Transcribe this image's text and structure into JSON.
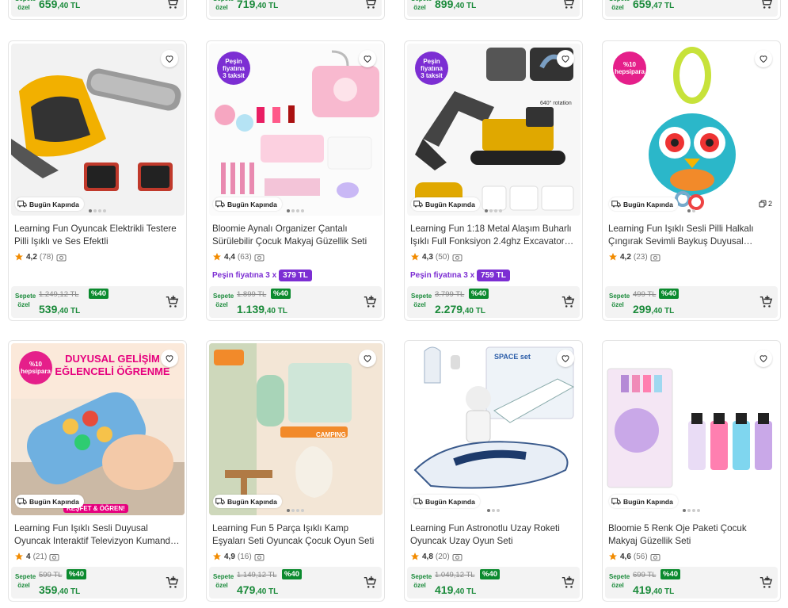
{
  "top_row": [
    {
      "price_main": "659",
      "price_dec": ",40 TL"
    },
    {
      "price_main": "719",
      "price_dec": ",40 TL"
    },
    {
      "price_main": "899",
      "price_dec": ",40 TL"
    },
    {
      "price_main": "659",
      "price_dec": ",47 TL"
    }
  ],
  "common": {
    "sepete": "Sepete özel",
    "delivery": "Bugün Kapında"
  },
  "products": [
    {
      "title": "Learning Fun Oyuncak Elektrikli Testere Pilli Işıklı ve Ses Efektli",
      "rating": "4,2",
      "count": "(78)",
      "old_price": "1.249,12 TL",
      "discount": "%40",
      "price_main": "539",
      "price_dec": ",40 TL"
    },
    {
      "title": "Bloomie Aynalı Organizer Çantalı Sürülebilir Çocuk Makyaj Güzellik Seti",
      "rating": "4,4",
      "count": "(63)",
      "old_price": "1.899 TL",
      "discount": "%40",
      "price_main": "1.139",
      "price_dec": ",40 TL",
      "badge": "Peşin fiyatına 3 taksit",
      "pesin_label": "Peşin fiyatına 3 x",
      "pesin_value": "379 TL"
    },
    {
      "title": "Learning Fun 1:18 Metal Alaşım Buharlı Işıklı Full Fonksiyon 2.4ghz Excavator…",
      "rating": "4,3",
      "count": "(50)",
      "old_price": "3.799 TL",
      "discount": "%40",
      "price_main": "2.279",
      "price_dec": ",40 TL",
      "badge": "Peşin fiyatına 3 taksit",
      "pesin_label": "Peşin fiyatına 3 x",
      "pesin_value": "759 TL",
      "image_text": "640° rotation"
    },
    {
      "title": "Learning Fun Işıklı Sesli Pilli Halkalı Çıngırak Sevimli Baykuş Duyusal…",
      "rating": "4,2",
      "count": "(23)",
      "old_price": "499 TL",
      "discount": "%40",
      "price_main": "299",
      "price_dec": ",40 TL",
      "badge": "%10 hepsipara",
      "multi_count": "2"
    },
    {
      "title": "Learning Fun Işıklı Sesli Duyusal Oyuncak Interaktif Televizyon Kumand…",
      "rating": "4",
      "count": "(21)",
      "old_price": "599 TL",
      "discount": "%40",
      "price_main": "359",
      "price_dec": ",40 TL",
      "badge": "%10 hepsipara",
      "image_text": "DUYUSAL GELİŞİM EĞLENCELİ ÖĞRENME",
      "image_text2": "KEŞFET & ÖĞREN!"
    },
    {
      "title": "Learning Fun 5 Parça Işıklı Kamp Eşyaları Seti Oyuncak Çocuk Oyun Seti",
      "rating": "4,9",
      "count": "(16)",
      "old_price": "1.149,12 TL",
      "discount": "%40",
      "price_main": "479",
      "price_dec": ",40 TL",
      "image_text": "CAMPING"
    },
    {
      "title": "Learning Fun Astronotlu Uzay Roketi Oyuncak Uzay Oyun Seti",
      "rating": "4,8",
      "count": "(20)",
      "old_price": "1.049,12 TL",
      "discount": "%40",
      "price_main": "419",
      "price_dec": ",40 TL",
      "image_text": "SPACE set"
    },
    {
      "title": "Bloomie 5 Renk Oje Paketi Çocuk Makyaj Güzellik Seti",
      "rating": "4,6",
      "count": "(56)",
      "old_price": "699 TL",
      "discount": "%40",
      "price_main": "419",
      "price_dec": ",40 TL"
    }
  ],
  "colors": {
    "green": "#1a8a3a",
    "purple": "#7c2ed3",
    "star": "#f28b00",
    "pink": "#e51f8a"
  }
}
